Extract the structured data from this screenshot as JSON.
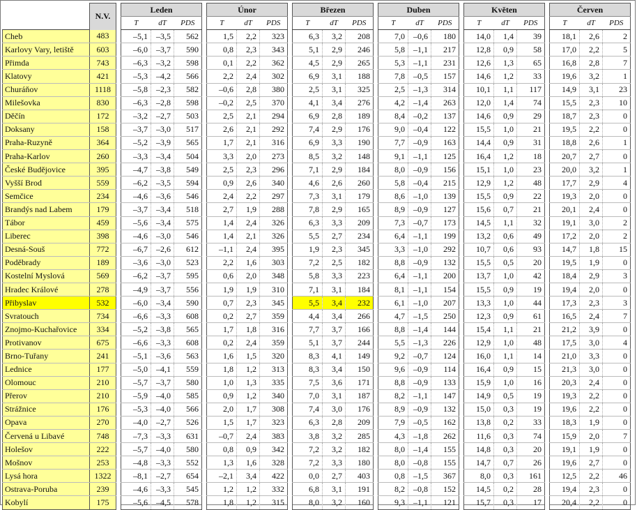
{
  "header": {
    "nv": "N.V.",
    "months": [
      "Leden",
      "Únor",
      "Březen",
      "Duben",
      "Květen",
      "Červen"
    ],
    "sub": [
      "T",
      "dT",
      "PDS"
    ]
  },
  "rows": [
    {
      "station": "Cheb",
      "nv": "483",
      "vals": [
        "–5,1",
        "–3,5",
        "562",
        "1,5",
        "2,2",
        "323",
        "6,3",
        "3,2",
        "208",
        "7,0",
        "–0,6",
        "180",
        "14,0",
        "1,4",
        "39",
        "18,1",
        "2,6",
        "2"
      ]
    },
    {
      "station": "Karlovy Vary, letiště",
      "nv": "603",
      "vals": [
        "–6,0",
        "–3,7",
        "590",
        "0,8",
        "2,3",
        "343",
        "5,1",
        "2,9",
        "246",
        "5,8",
        "–1,1",
        "217",
        "12,8",
        "0,9",
        "58",
        "17,0",
        "2,2",
        "5"
      ]
    },
    {
      "station": "Přimda",
      "nv": "743",
      "vals": [
        "–6,3",
        "–3,2",
        "598",
        "0,1",
        "2,2",
        "362",
        "4,5",
        "2,9",
        "265",
        "5,3",
        "–1,1",
        "231",
        "12,6",
        "1,3",
        "65",
        "16,8",
        "2,8",
        "7"
      ]
    },
    {
      "station": "Klatovy",
      "nv": "421",
      "vals": [
        "–5,3",
        "–4,2",
        "566",
        "2,2",
        "2,4",
        "302",
        "6,9",
        "3,1",
        "188",
        "7,8",
        "–0,5",
        "157",
        "14,6",
        "1,2",
        "33",
        "19,6",
        "3,2",
        "1"
      ]
    },
    {
      "station": "Churáňov",
      "nv": "1118",
      "vals": [
        "–5,8",
        "–2,3",
        "582",
        "–0,6",
        "2,8",
        "380",
        "2,5",
        "3,1",
        "325",
        "2,5",
        "–1,3",
        "314",
        "10,1",
        "1,1",
        "117",
        "14,9",
        "3,1",
        "23"
      ]
    },
    {
      "station": "Milešovka",
      "nv": "830",
      "vals": [
        "–6,3",
        "–2,8",
        "598",
        "–0,2",
        "2,5",
        "370",
        "4,1",
        "3,4",
        "276",
        "4,2",
        "–1,4",
        "263",
        "12,0",
        "1,4",
        "74",
        "15,5",
        "2,3",
        "10"
      ]
    },
    {
      "station": "Děčín",
      "nv": "172",
      "vals": [
        "–3,2",
        "–2,7",
        "503",
        "2,5",
        "2,1",
        "294",
        "6,9",
        "2,8",
        "189",
        "8,4",
        "–0,2",
        "137",
        "14,6",
        "0,9",
        "29",
        "18,7",
        "2,3",
        "0"
      ]
    },
    {
      "station": "Doksany",
      "nv": "158",
      "vals": [
        "–3,7",
        "–3,0",
        "517",
        "2,6",
        "2,1",
        "292",
        "7,4",
        "2,9",
        "176",
        "9,0",
        "–0,4",
        "122",
        "15,5",
        "1,0",
        "21",
        "19,5",
        "2,2",
        "0"
      ]
    },
    {
      "station": "Praha-Ruzyně",
      "nv": "364",
      "vals": [
        "–5,2",
        "–3,9",
        "565",
        "1,7",
        "2,1",
        "316",
        "6,9",
        "3,3",
        "190",
        "7,7",
        "–0,9",
        "163",
        "14,4",
        "0,9",
        "31",
        "18,8",
        "2,6",
        "1"
      ]
    },
    {
      "station": "Praha-Karlov",
      "nv": "260",
      "vals": [
        "–3,3",
        "–3,4",
        "504",
        "3,3",
        "2,0",
        "273",
        "8,5",
        "3,2",
        "148",
        "9,1",
        "–1,1",
        "125",
        "16,4",
        "1,2",
        "18",
        "20,7",
        "2,7",
        "0"
      ]
    },
    {
      "station": "České Budějovice",
      "nv": "395",
      "vals": [
        "–4,7",
        "–3,8",
        "549",
        "2,5",
        "2,3",
        "296",
        "7,1",
        "2,9",
        "184",
        "8,0",
        "–0,9",
        "156",
        "15,1",
        "1,0",
        "23",
        "20,0",
        "3,2",
        "1"
      ]
    },
    {
      "station": "Vyšší Brod",
      "nv": "559",
      "vals": [
        "–6,2",
        "–3,5",
        "594",
        "0,9",
        "2,6",
        "340",
        "4,6",
        "2,6",
        "260",
        "5,8",
        "–0,4",
        "215",
        "12,9",
        "1,2",
        "48",
        "17,7",
        "2,9",
        "4"
      ]
    },
    {
      "station": "Semčice",
      "nv": "234",
      "vals": [
        "–4,6",
        "–3,6",
        "546",
        "2,4",
        "2,2",
        "297",
        "7,3",
        "3,1",
        "179",
        "8,6",
        "–1,0",
        "139",
        "15,5",
        "0,9",
        "22",
        "19,3",
        "2,0",
        "0"
      ]
    },
    {
      "station": "Brandýs nad Labem",
      "nv": "179",
      "vals": [
        "–3,7",
        "–3,4",
        "518",
        "2,7",
        "1,9",
        "288",
        "7,8",
        "2,9",
        "165",
        "8,9",
        "–0,9",
        "127",
        "15,6",
        "0,7",
        "21",
        "20,1",
        "2,4",
        "0"
      ]
    },
    {
      "station": "Tábor",
      "nv": "459",
      "vals": [
        "–5,6",
        "–3,4",
        "575",
        "1,4",
        "2,4",
        "326",
        "6,3",
        "3,3",
        "209",
        "7,3",
        "–0,7",
        "173",
        "14,5",
        "1,1",
        "32",
        "19,1",
        "3,0",
        "2"
      ]
    },
    {
      "station": "Liberec",
      "nv": "398",
      "vals": [
        "–4,6",
        "–3,0",
        "546",
        "1,4",
        "2,1",
        "326",
        "5,5",
        "2,7",
        "234",
        "6,4",
        "–1,1",
        "199",
        "13,2",
        "0,6",
        "49",
        "17,2",
        "2,0",
        "2"
      ]
    },
    {
      "station": "Desná-Souš",
      "nv": "772",
      "vals": [
        "–6,7",
        "–2,6",
        "612",
        "–1,1",
        "2,4",
        "395",
        "1,9",
        "2,3",
        "345",
        "3,3",
        "–1,0",
        "292",
        "10,7",
        "0,6",
        "93",
        "14,7",
        "1,8",
        "15"
      ]
    },
    {
      "station": "Poděbrady",
      "nv": "189",
      "vals": [
        "–3,6",
        "–3,0",
        "523",
        "2,2",
        "1,6",
        "303",
        "7,2",
        "2,5",
        "182",
        "8,8",
        "–0,9",
        "132",
        "15,5",
        "0,5",
        "20",
        "19,5",
        "1,9",
        "0"
      ]
    },
    {
      "station": "Kostelní Myslová",
      "nv": "569",
      "vals": [
        "–6,2",
        "–3,7",
        "595",
        "0,6",
        "2,0",
        "348",
        "5,8",
        "3,3",
        "223",
        "6,4",
        "–1,1",
        "200",
        "13,7",
        "1,0",
        "42",
        "18,4",
        "2,9",
        "3"
      ]
    },
    {
      "station": "Hradec Králové",
      "nv": "278",
      "vals": [
        "–4,9",
        "–3,7",
        "556",
        "1,9",
        "1,9",
        "310",
        "7,1",
        "3,1",
        "184",
        "8,1",
        "–1,1",
        "154",
        "15,5",
        "0,9",
        "19",
        "19,4",
        "2,0",
        "0"
      ]
    },
    {
      "station": "Přibyslav",
      "nv": "532",
      "hl": true,
      "vals": [
        "–6,0",
        "–3,4",
        "590",
        "0,7",
        "2,3",
        "345",
        "5,5",
        "3,4",
        "232",
        "6,1",
        "–1,0",
        "207",
        "13,3",
        "1,0",
        "44",
        "17,3",
        "2,3",
        "3"
      ]
    },
    {
      "station": "Svratouch",
      "nv": "734",
      "vals": [
        "–6,6",
        "–3,3",
        "608",
        "0,2",
        "2,7",
        "359",
        "4,4",
        "3,4",
        "266",
        "4,7",
        "–1,5",
        "250",
        "12,3",
        "0,9",
        "61",
        "16,5",
        "2,4",
        "7"
      ]
    },
    {
      "station": "Znojmo-Kuchařovice",
      "nv": "334",
      "vals": [
        "–5,2",
        "–3,8",
        "565",
        "1,7",
        "1,8",
        "316",
        "7,7",
        "3,7",
        "166",
        "8,8",
        "–1,4",
        "144",
        "15,4",
        "1,1",
        "21",
        "21,2",
        "3,9",
        "0"
      ]
    },
    {
      "station": "Protivanov",
      "nv": "675",
      "vals": [
        "–6,6",
        "–3,3",
        "608",
        "0,2",
        "2,4",
        "359",
        "5,1",
        "3,7",
        "244",
        "5,5",
        "–1,3",
        "226",
        "12,9",
        "1,0",
        "48",
        "17,5",
        "3,0",
        "4"
      ]
    },
    {
      "station": "Brno-Tuřany",
      "nv": "241",
      "vals": [
        "–5,1",
        "–3,6",
        "563",
        "1,6",
        "1,5",
        "320",
        "8,3",
        "4,1",
        "149",
        "9,2",
        "–0,7",
        "124",
        "16,0",
        "1,1",
        "14",
        "21,0",
        "3,3",
        "0"
      ]
    },
    {
      "station": "Lednice",
      "nv": "177",
      "vals": [
        "–5,0",
        "–4,1",
        "559",
        "1,8",
        "1,2",
        "313",
        "8,3",
        "3,4",
        "150",
        "9,6",
        "–0,9",
        "114",
        "16,4",
        "0,9",
        "15",
        "21,3",
        "3,0",
        "0"
      ]
    },
    {
      "station": "Olomouc",
      "nv": "210",
      "vals": [
        "–5,7",
        "–3,7",
        "580",
        "1,0",
        "1,3",
        "335",
        "7,5",
        "3,6",
        "171",
        "8,8",
        "–0,9",
        "133",
        "15,9",
        "1,0",
        "16",
        "20,3",
        "2,4",
        "0"
      ]
    },
    {
      "station": "Přerov",
      "nv": "210",
      "vals": [
        "–5,9",
        "–4,0",
        "585",
        "0,9",
        "1,2",
        "340",
        "7,0",
        "3,1",
        "187",
        "8,2",
        "–1,1",
        "147",
        "14,9",
        "0,5",
        "19",
        "19,3",
        "2,2",
        "0"
      ]
    },
    {
      "station": "Strážnice",
      "nv": "176",
      "vals": [
        "–5,3",
        "–4,0",
        "566",
        "2,0",
        "1,7",
        "308",
        "7,4",
        "3,0",
        "176",
        "8,9",
        "–0,9",
        "132",
        "15,0",
        "0,3",
        "19",
        "19,6",
        "2,2",
        "0"
      ]
    },
    {
      "station": "Opava",
      "nv": "270",
      "vals": [
        "–4,0",
        "–2,7",
        "526",
        "1,5",
        "1,7",
        "323",
        "6,3",
        "2,8",
        "209",
        "7,9",
        "–0,5",
        "162",
        "13,8",
        "0,2",
        "33",
        "18,3",
        "1,9",
        "0"
      ]
    },
    {
      "station": "Červená u Libavé",
      "nv": "748",
      "vals": [
        "–7,3",
        "–3,3",
        "631",
        "–0,7",
        "2,4",
        "383",
        "3,8",
        "3,2",
        "285",
        "4,3",
        "–1,8",
        "262",
        "11,6",
        "0,3",
        "74",
        "15,9",
        "2,0",
        "7"
      ]
    },
    {
      "station": "Holešov",
      "nv": "222",
      "vals": [
        "–5,7",
        "–4,0",
        "580",
        "0,8",
        "0,9",
        "342",
        "7,2",
        "3,2",
        "182",
        "8,0",
        "–1,4",
        "155",
        "14,8",
        "0,3",
        "20",
        "19,1",
        "1,9",
        "0"
      ]
    },
    {
      "station": "Mošnov",
      "nv": "253",
      "vals": [
        "–4,8",
        "–3,3",
        "552",
        "1,3",
        "1,6",
        "328",
        "7,2",
        "3,3",
        "180",
        "8,0",
        "–0,8",
        "155",
        "14,7",
        "0,7",
        "26",
        "19,6",
        "2,7",
        "0"
      ]
    },
    {
      "station": "Lysá hora",
      "nv": "1322",
      "vals": [
        "–8,1",
        "–2,7",
        "654",
        "–2,1",
        "3,4",
        "422",
        "0,0",
        "2,7",
        "403",
        "0,8",
        "–1,5",
        "367",
        "8,0",
        "0,3",
        "161",
        "12,5",
        "2,2",
        "46"
      ]
    },
    {
      "station": "Ostrava-Poruba",
      "nv": "239",
      "vals": [
        "–4,6",
        "–3,3",
        "545",
        "1,2",
        "1,2",
        "332",
        "6,8",
        "3,1",
        "191",
        "8,2",
        "–0,8",
        "152",
        "14,5",
        "0,2",
        "28",
        "19,4",
        "2,3",
        "0"
      ]
    },
    {
      "station": "Kobylí",
      "nv": "175",
      "vals": [
        "–5,6",
        "–4,5",
        "578",
        "1,8",
        "1,2",
        "315",
        "8,0",
        "3,2",
        "160",
        "9,3",
        "–1,1",
        "121",
        "15,7",
        "0,3",
        "17",
        "20,4",
        "2,2",
        "0"
      ]
    }
  ],
  "highlight": {
    "row_station": "Přibyslav",
    "month": "Březen",
    "color": "#ffff00"
  },
  "colors": {
    "station_bg": "#ffff99",
    "header_bg": "#d9d9d9",
    "highlight": "#ffff00"
  }
}
